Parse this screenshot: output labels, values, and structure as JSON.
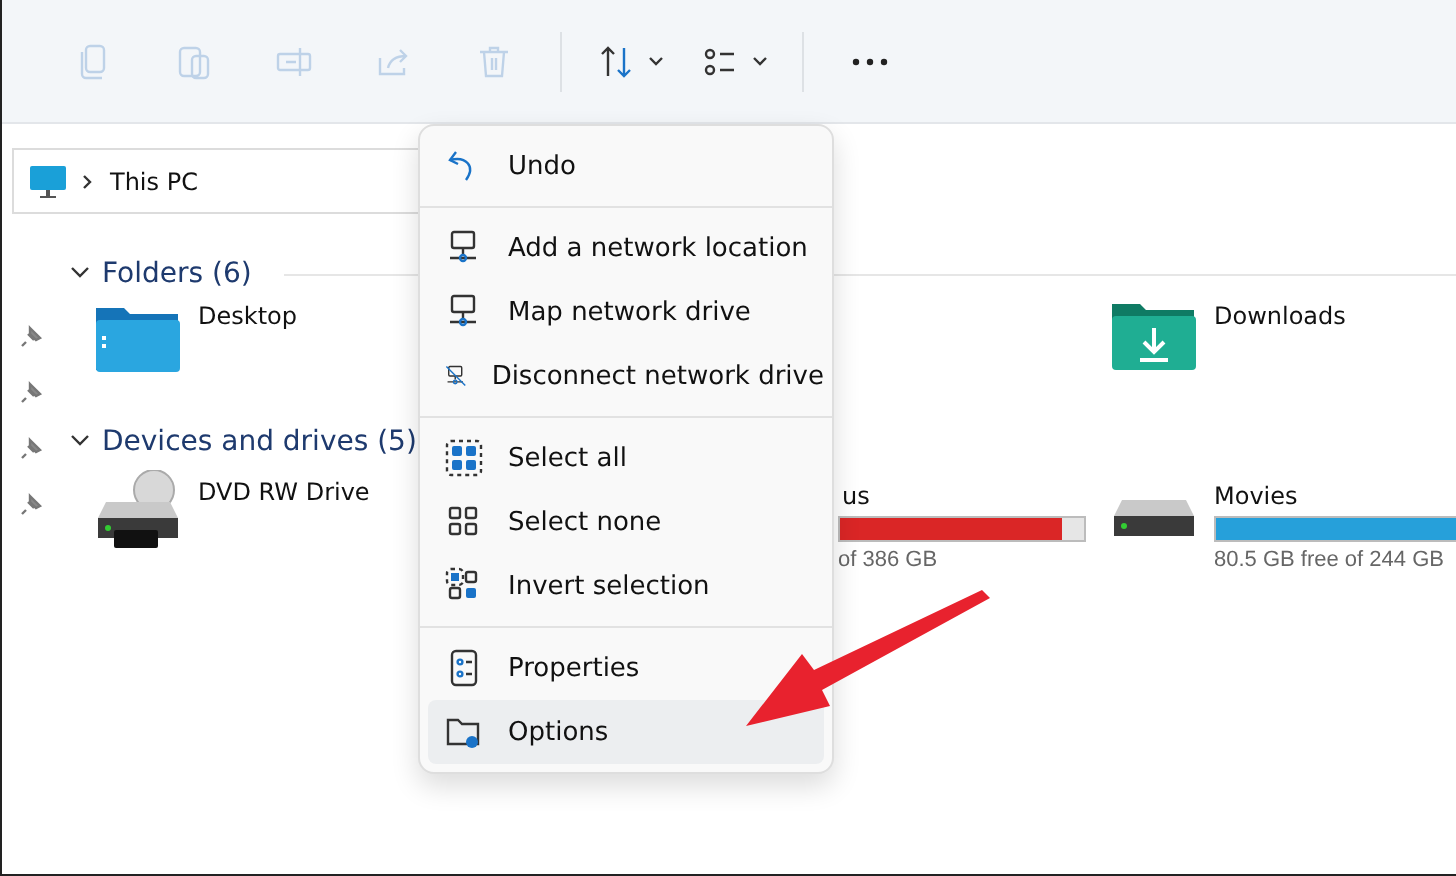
{
  "toolbar": {
    "buttons": [
      {
        "disabled": true
      },
      {
        "disabled": true
      },
      {
        "disabled": true
      },
      {
        "disabled": true
      },
      {
        "disabled": true
      },
      {
        "disabled": false,
        "dropdown": true
      },
      {
        "disabled": false,
        "dropdown": true
      },
      {
        "disabled": false,
        "dropdown": false
      }
    ]
  },
  "address": {
    "path": "This PC"
  },
  "sections": [
    {
      "title": "Folders (6)",
      "expanded": true
    },
    {
      "title": "Devices and drives (5)",
      "expanded": true
    }
  ],
  "folders": [
    {
      "name": "Desktop"
    },
    {
      "name": "Downloads"
    }
  ],
  "drives": [
    {
      "name": "DVD RW Drive",
      "kind": "dvd"
    },
    {
      "name": "us",
      "kind": "partial",
      "level": 0.91,
      "free": "of 386 GB",
      "color": "#da2626"
    },
    {
      "name": "Movies",
      "kind": "disk",
      "level": 0.67,
      "free": "80.5 GB free of 244 GB",
      "color": "#26a0da"
    }
  ],
  "menu": {
    "groups": [
      [
        {
          "label": "Undo",
          "highlighted": false
        }
      ],
      [
        {
          "label": "Add a network location",
          "highlighted": false
        },
        {
          "label": "Map network drive",
          "highlighted": false
        },
        {
          "label": "Disconnect network drive",
          "highlighted": false
        }
      ],
      [
        {
          "label": "Select all",
          "highlighted": false
        },
        {
          "label": "Select none",
          "highlighted": false
        },
        {
          "label": "Invert selection",
          "highlighted": false
        }
      ],
      [
        {
          "label": "Properties",
          "highlighted": false
        },
        {
          "label": "Options",
          "highlighted": true
        }
      ]
    ]
  }
}
